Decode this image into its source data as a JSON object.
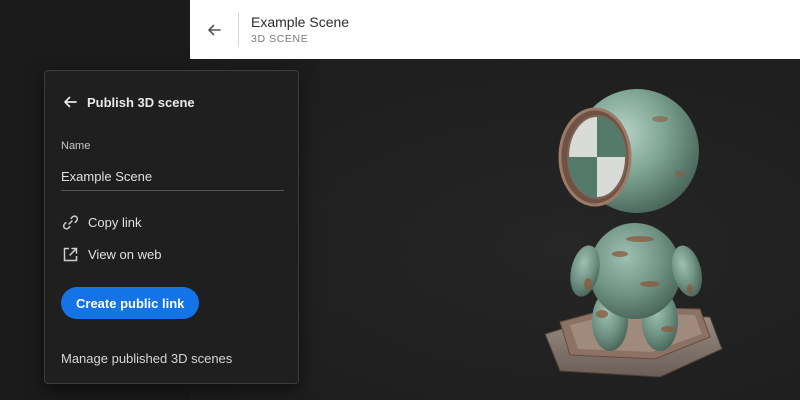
{
  "header": {
    "title": "Example Scene",
    "subtitle": "3D SCENE"
  },
  "panel": {
    "title": "Publish 3D scene",
    "name_label": "Name",
    "name_value": "Example Scene",
    "copy_link_label": "Copy link",
    "view_on_web_label": "View on web",
    "create_button_label": "Create public link",
    "manage_link_label": "Manage published 3D scenes"
  },
  "colors": {
    "accent": "#1473e6",
    "panel_bg": "#1f1f1f",
    "header_bg": "#ffffff"
  },
  "icons": {
    "header_back": "arrow-left-icon",
    "panel_back": "arrow-left-icon",
    "copy": "link-icon",
    "web": "external-link-icon"
  }
}
